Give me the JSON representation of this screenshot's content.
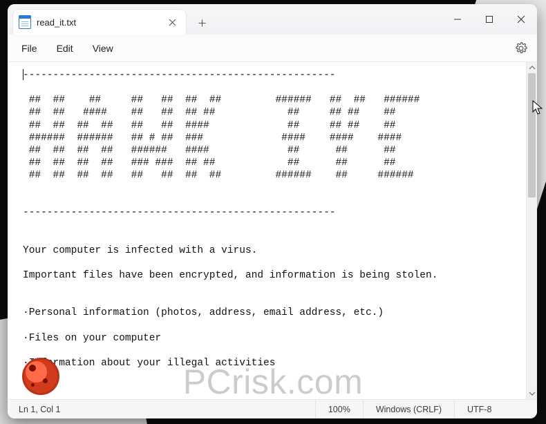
{
  "tab": {
    "title": "read_it.txt"
  },
  "menu": {
    "file": "File",
    "edit": "Edit",
    "view": "View"
  },
  "status": {
    "position": "Ln 1, Col 1",
    "zoom": "100%",
    "eol": "Windows (CRLF)",
    "encoding": "UTF-8"
  },
  "watermark": "PCrisk.com",
  "editor": {
    "text": "----------------------------------------------------\n\n ##  ##    ##     ##   ##  ##  ##         ######   ##  ##   ######\n ##  ##   ####    ##   ##  ## ##            ##     ## ##    ##\n ##  ##  ##  ##   ##   ##  ####             ##     ## ##    ##\n ######  ######   ## # ##  ###             ####    ####    ####\n ##  ##  ##  ##   ######   ####             ##      ##      ##\n ##  ##  ##  ##   ### ###  ## ##            ##      ##      ##\n ##  ##  ##  ##   ##   ##  ##  ##         ######    ##     ######\n\n\n----------------------------------------------------\n\n\nYour computer is infected with a virus.\n\nImportant files have been encrypted, and information is being stolen.\n\n\n·Personal information (photos, address, email address, etc.)\n\n·Files on your computer\n\n·Information about your illegal activities"
  }
}
